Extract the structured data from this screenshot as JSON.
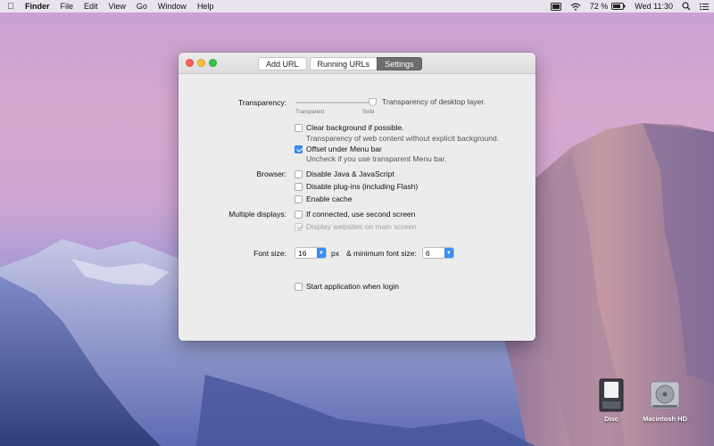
{
  "menubar": {
    "app_name": "Finder",
    "items": [
      "File",
      "Edit",
      "View",
      "Go",
      "Window",
      "Help"
    ],
    "battery_percent": "72 %",
    "clock": "Wed 11:30"
  },
  "window": {
    "tabs": [
      {
        "label": "Add URL",
        "active": false
      },
      {
        "label": "Running URLs",
        "active": false
      },
      {
        "label": "Settings",
        "active": true
      }
    ]
  },
  "settings": {
    "transparency": {
      "label": "Transparency:",
      "min_label": "Transparent",
      "max_label": "Solid",
      "description": "Transparency of desktop layer.",
      "value_fraction": 0.95
    },
    "clear_background": {
      "label": "Clear background if possible.",
      "checked": false,
      "hint": "Transparency of web content without explicit background."
    },
    "offset_menu_bar": {
      "label": "Offset under Menu bar",
      "checked": true,
      "hint": "Uncheck if you use transparent Menu bar."
    },
    "browser": {
      "label": "Browser:",
      "disable_java": "Disable Java & JavaScript",
      "disable_plugins": "Disable plug-ins (including Flash)",
      "enable_cache": "Enable cache"
    },
    "multiple_displays": {
      "label": "Multiple displays:",
      "second_screen": "If connected, use second screen",
      "main_screen": "Display websites on main screen"
    },
    "font_size": {
      "label": "Font size:",
      "value": "16",
      "unit": "px",
      "min_label": "& minimum font size:",
      "min_value": "6"
    },
    "start_at_login": "Start application when login"
  },
  "desktop": {
    "icons": [
      {
        "label": "Disc"
      },
      {
        "label": "Macintosh HD"
      }
    ]
  },
  "colors": {
    "accent": "#3b8ef3",
    "window_bg": "#ececec"
  }
}
